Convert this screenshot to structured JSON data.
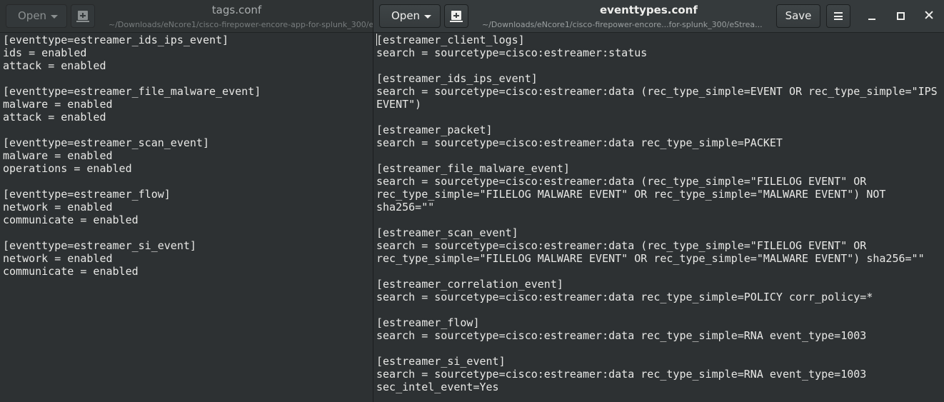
{
  "left_window": {
    "open_label": "Open",
    "title": "tags.conf",
    "subtitle": "~/Downloads/eNcore1/cisco-firepower-encore-app-for-splunk_300/e",
    "lines": [
      "[eventtype=estreamer_ids_ips_event]",
      "ids = enabled",
      "attack = enabled",
      "",
      "[eventtype=estreamer_file_malware_event]",
      "malware = enabled",
      "attack = enabled",
      "",
      "[eventtype=estreamer_scan_event]",
      "malware = enabled",
      "operations = enabled",
      "",
      "[eventtype=estreamer_flow]",
      "network = enabled",
      "communicate = enabled",
      "",
      "[eventtype=estreamer_si_event]",
      "network = enabled",
      "communicate = enabled"
    ]
  },
  "right_window": {
    "open_label": "Open",
    "title": "eventtypes.conf",
    "subtitle": "~/Downloads/eNcore1/cisco-firepower-encore...for-splunk_300/eStrea...",
    "save_label": "Save",
    "lines": [
      "[estreamer_client_logs]",
      "search = sourcetype=cisco:estreamer:status",
      "",
      "[estreamer_ids_ips_event]",
      "search = sourcetype=cisco:estreamer:data (rec_type_simple=EVENT OR rec_type_simple=\"IPS",
      "EVENT\")",
      "",
      "[estreamer_packet]",
      "search = sourcetype=cisco:estreamer:data rec_type_simple=PACKET",
      "",
      "[estreamer_file_malware_event]",
      "search = sourcetype=cisco:estreamer:data (rec_type_simple=\"FILELOG EVENT\" OR",
      "rec_type_simple=\"FILELOG MALWARE EVENT\" OR rec_type_simple=\"MALWARE EVENT\") NOT",
      "sha256=\"\"",
      "",
      "[estreamer_scan_event]",
      "search = sourcetype=cisco:estreamer:data (rec_type_simple=\"FILELOG EVENT\" OR",
      "rec_type_simple=\"FILELOG MALWARE EVENT\" OR rec_type_simple=\"MALWARE EVENT\") sha256=\"\"",
      "",
      "[estreamer_correlation_event]",
      "search = sourcetype=cisco:estreamer:data rec_type_simple=POLICY corr_policy=*",
      "",
      "[estreamer_flow]",
      "search = sourcetype=cisco:estreamer:data rec_type_simple=RNA event_type=1003",
      "",
      "[estreamer_si_event]",
      "search = sourcetype=cisco:estreamer:data rec_type_simple=RNA event_type=1003",
      "sec_intel_event=Yes"
    ]
  },
  "icons": {
    "open_dropdown": "chevron-down-icon",
    "new_document": "new-document-icon",
    "menu": "hamburger-menu-icon",
    "minimize": "minimize-icon",
    "maximize": "maximize-icon",
    "close": "close-icon"
  },
  "colors": {
    "editor_background": "#2d3133",
    "headerbar_background": "#353a3c",
    "text": "#e8e8e6"
  }
}
